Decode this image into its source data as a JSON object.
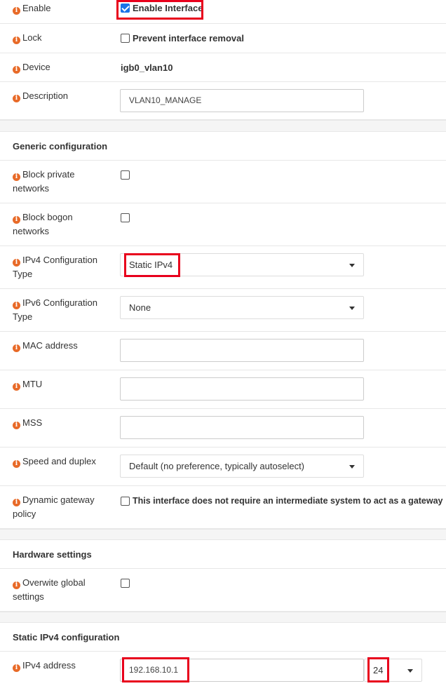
{
  "rows": {
    "enable": {
      "label": "Enable",
      "checkbox_label": "Enable Interface",
      "checked": true
    },
    "lock": {
      "label": "Lock",
      "checkbox_label": "Prevent interface removal",
      "checked": false
    },
    "device": {
      "label": "Device",
      "value": "igb0_vlan10"
    },
    "description": {
      "label": "Description",
      "value": "VLAN10_MANAGE"
    }
  },
  "generic": {
    "title": "Generic configuration",
    "block_private": {
      "label_line1": "Block private",
      "label_line2": "networks"
    },
    "block_bogon": {
      "label_line1": "Block bogon",
      "label_line2": "networks"
    },
    "ipv4_type": {
      "label_line1": "IPv4 Configuration",
      "label_line2": "Type",
      "value": "Static IPv4"
    },
    "ipv6_type": {
      "label_line1": "IPv6 Configuration",
      "label_line2": "Type",
      "value": "None"
    },
    "mac": {
      "label": "MAC address",
      "value": ""
    },
    "mtu": {
      "label": "MTU",
      "value": ""
    },
    "mss": {
      "label": "MSS",
      "value": ""
    },
    "speed": {
      "label": "Speed and duplex",
      "value": "Default (no preference, typically autoselect)"
    },
    "gateway_policy": {
      "label_line1": "Dynamic gateway",
      "label_line2": "policy",
      "checkbox_label": "This interface does not require an intermediate system to act as a gateway"
    }
  },
  "hardware": {
    "title": "Hardware settings",
    "overwrite": {
      "label_line1": "Overwite global",
      "label_line2": "settings"
    }
  },
  "static_ipv4": {
    "title": "Static IPv4 configuration",
    "address": {
      "label": "IPv4 address",
      "value": "192.168.10.1",
      "prefix": "24"
    }
  },
  "icons": {
    "info": "info-icon"
  },
  "colors": {
    "highlight": "#e8001c",
    "info_icon": "#e86a28",
    "checkbox_checked": "#1a73e8"
  }
}
